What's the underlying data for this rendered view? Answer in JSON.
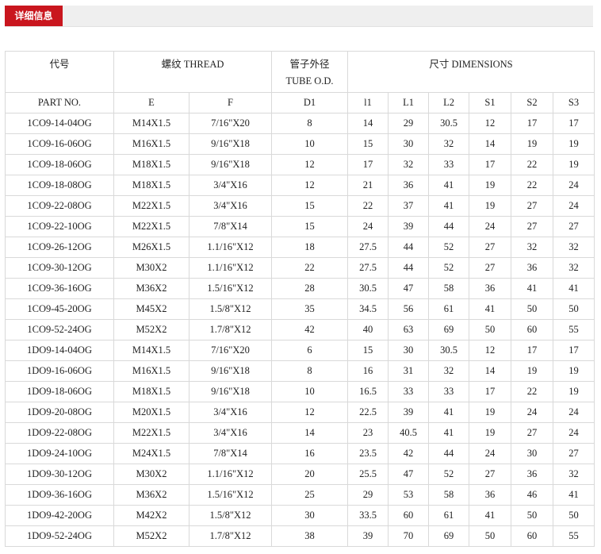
{
  "tab": {
    "label": "详细信息"
  },
  "table": {
    "group_headers": {
      "part": "代号",
      "thread": "螺纹 THREAD",
      "tube_cn": "管子外径",
      "tube_en": "TUBE O.D.",
      "dimensions": "尺寸 DIMENSIONS"
    },
    "columns": [
      "PART NO.",
      "E",
      "F",
      "D1",
      "l1",
      "L1",
      "L2",
      "S1",
      "S2",
      "S3"
    ],
    "rows": [
      [
        "1CO9-14-04OG",
        "M14X1.5",
        "7/16\"X20",
        "8",
        "14",
        "29",
        "30.5",
        "12",
        "17",
        "17"
      ],
      [
        "1CO9-16-06OG",
        "M16X1.5",
        "9/16\"X18",
        "10",
        "15",
        "30",
        "32",
        "14",
        "19",
        "19"
      ],
      [
        "1CO9-18-06OG",
        "M18X1.5",
        "9/16\"X18",
        "12",
        "17",
        "32",
        "33",
        "17",
        "22",
        "19"
      ],
      [
        "1CO9-18-08OG",
        "M18X1.5",
        "3/4\"X16",
        "12",
        "21",
        "36",
        "41",
        "19",
        "22",
        "24"
      ],
      [
        "1CO9-22-08OG",
        "M22X1.5",
        "3/4\"X16",
        "15",
        "22",
        "37",
        "41",
        "19",
        "27",
        "24"
      ],
      [
        "1CO9-22-10OG",
        "M22X1.5",
        "7/8\"X14",
        "15",
        "24",
        "39",
        "44",
        "24",
        "27",
        "27"
      ],
      [
        "1CO9-26-12OG",
        "M26X1.5",
        "1.1/16\"X12",
        "18",
        "27.5",
        "44",
        "52",
        "27",
        "32",
        "32"
      ],
      [
        "1CO9-30-12OG",
        "M30X2",
        "1.1/16\"X12",
        "22",
        "27.5",
        "44",
        "52",
        "27",
        "36",
        "32"
      ],
      [
        "1CO9-36-16OG",
        "M36X2",
        "1.5/16\"X12",
        "28",
        "30.5",
        "47",
        "58",
        "36",
        "41",
        "41"
      ],
      [
        "1CO9-45-20OG",
        "M45X2",
        "1.5/8\"X12",
        "35",
        "34.5",
        "56",
        "61",
        "41",
        "50",
        "50"
      ],
      [
        "1CO9-52-24OG",
        "M52X2",
        "1.7/8\"X12",
        "42",
        "40",
        "63",
        "69",
        "50",
        "60",
        "55"
      ],
      [
        "1DO9-14-04OG",
        "M14X1.5",
        "7/16\"X20",
        "6",
        "15",
        "30",
        "30.5",
        "12",
        "17",
        "17"
      ],
      [
        "1DO9-16-06OG",
        "M16X1.5",
        "9/16\"X18",
        "8",
        "16",
        "31",
        "32",
        "14",
        "19",
        "19"
      ],
      [
        "1DO9-18-06OG",
        "M18X1.5",
        "9/16\"X18",
        "10",
        "16.5",
        "33",
        "33",
        "17",
        "22",
        "19"
      ],
      [
        "1DO9-20-08OG",
        "M20X1.5",
        "3/4\"X16",
        "12",
        "22.5",
        "39",
        "41",
        "19",
        "24",
        "24"
      ],
      [
        "1DO9-22-08OG",
        "M22X1.5",
        "3/4\"X16",
        "14",
        "23",
        "40.5",
        "41",
        "19",
        "27",
        "24"
      ],
      [
        "1DO9-24-10OG",
        "M24X1.5",
        "7/8\"X14",
        "16",
        "23.5",
        "42",
        "44",
        "24",
        "30",
        "27"
      ],
      [
        "1DO9-30-12OG",
        "M30X2",
        "1.1/16\"X12",
        "20",
        "25.5",
        "47",
        "52",
        "27",
        "36",
        "32"
      ],
      [
        "1DO9-36-16OG",
        "M36X2",
        "1.5/16\"X12",
        "25",
        "29",
        "53",
        "58",
        "36",
        "46",
        "41"
      ],
      [
        "1DO9-42-20OG",
        "M42X2",
        "1.5/8\"X12",
        "30",
        "33.5",
        "60",
        "61",
        "41",
        "50",
        "50"
      ],
      [
        "1DO9-52-24OG",
        "M52X2",
        "1.7/8\"X12",
        "38",
        "39",
        "70",
        "69",
        "50",
        "60",
        "55"
      ]
    ]
  }
}
